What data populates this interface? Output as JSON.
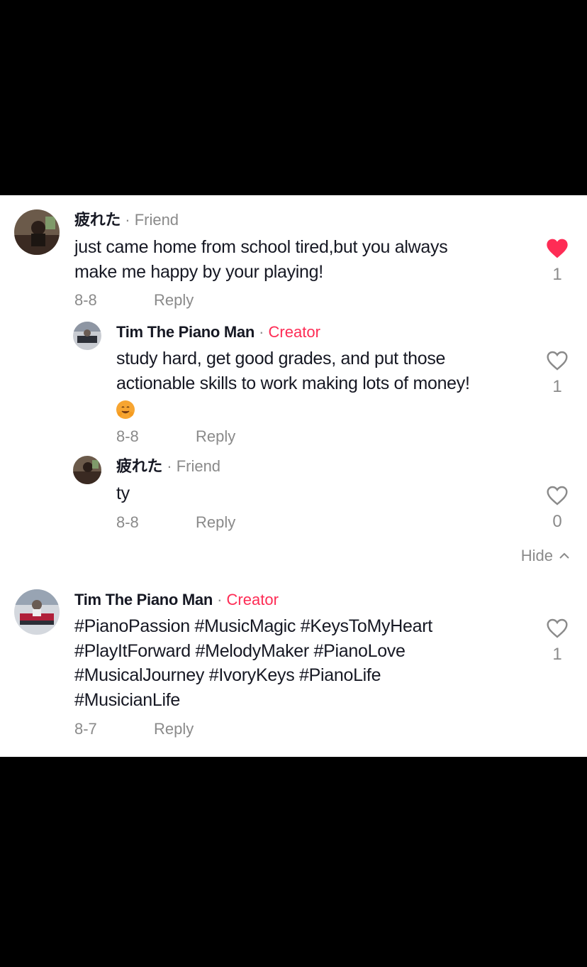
{
  "comments": [
    {
      "author": "疲れた",
      "separator": "·",
      "badge": "Friend",
      "text_line1": "just came home from school tired,but you always",
      "text_line2": "make me happy by your playing!",
      "date": "8-8",
      "reply_label": "Reply",
      "likes": "1",
      "liked": true,
      "like_color": "#fe2c55"
    },
    {
      "author": "Tim The Piano Man",
      "separator": "·",
      "badge": "Creator",
      "text_line1": "study hard, get good grades, and put those",
      "text_line2": "actionable skills to work making lots of money!",
      "emoji": "hugging-face-emoji",
      "date": "8-8",
      "reply_label": "Reply",
      "likes": "1",
      "liked": false
    },
    {
      "author": "疲れた",
      "separator": "·",
      "badge": "Friend",
      "text_line1": "ty",
      "date": "8-8",
      "reply_label": "Reply",
      "likes": "0",
      "liked": false
    },
    {
      "author": "Tim The Piano Man",
      "separator": "·",
      "badge": "Creator",
      "text_line1": "#PianoPassion #MusicMagic #KeysToMyHeart",
      "text_line2": "#PlayItForward #MelodyMaker #PianoLove",
      "text_line3": "#MusicalJourney #IvoryKeys #PianoLife",
      "text_line4": "#MusicianLife",
      "date": "8-7",
      "reply_label": "Reply",
      "likes": "1",
      "liked": false
    }
  ],
  "hide_label": "Hide",
  "colors": {
    "creator": "#fe2c55",
    "muted": "#8a8a8a",
    "text": "#161823"
  },
  "icons": {
    "like": "heart-icon",
    "hide": "chevron-up-icon"
  }
}
